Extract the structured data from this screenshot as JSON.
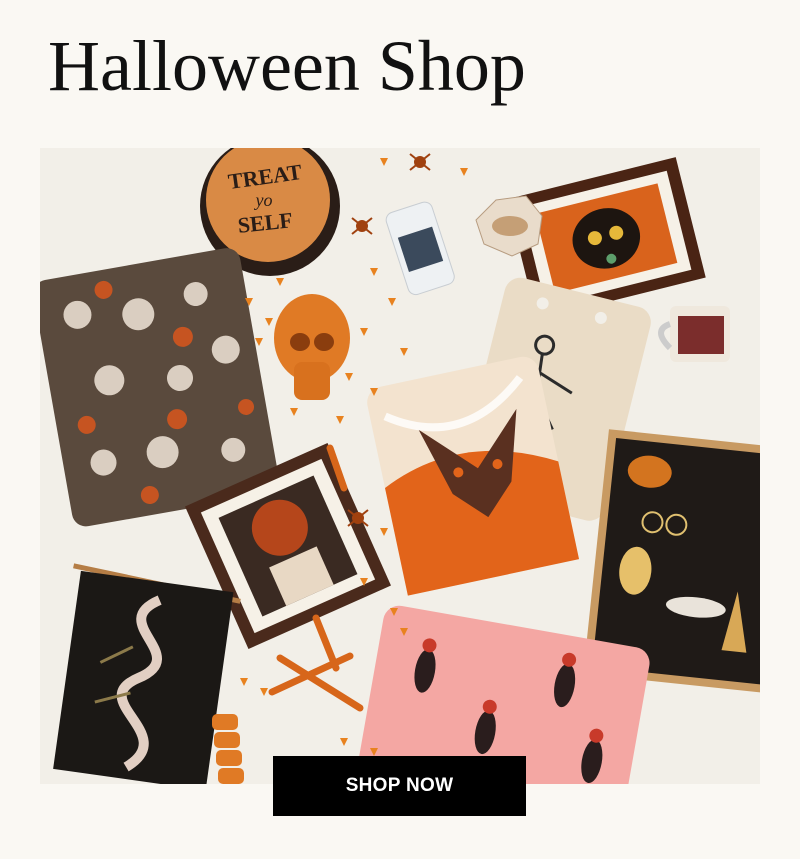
{
  "page": {
    "title": "Halloween Shop",
    "cta_label": "SHOP NOW"
  },
  "hero": {
    "tray_text": [
      "TREAT",
      "yo",
      "SELF"
    ]
  },
  "colors": {
    "background": "#faf8f3",
    "photo_background": "#f2efe8",
    "button": "#000000",
    "button_text": "#ffffff",
    "accent_orange": "#e0741f"
  }
}
